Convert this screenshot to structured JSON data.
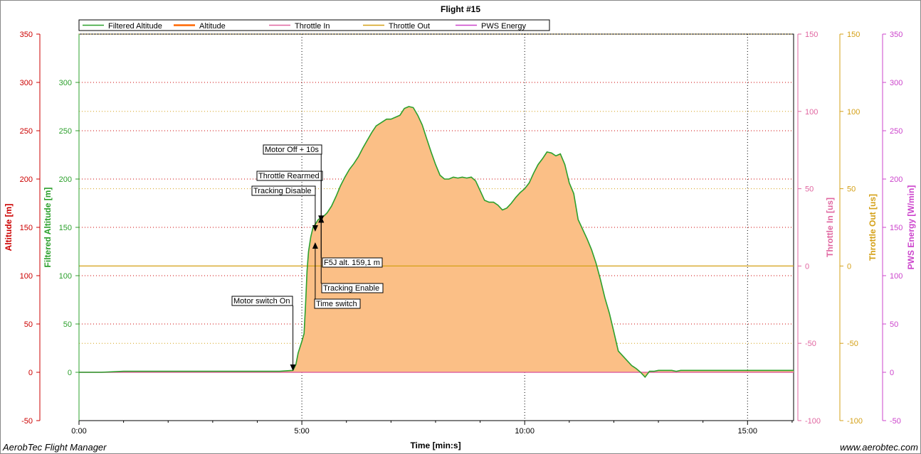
{
  "chart_data": {
    "type": "area",
    "title": "Flight #15",
    "xlabel": "Time [min:s]",
    "x_ticks": [
      "0:00",
      "5:00",
      "10:00",
      "15:00"
    ],
    "xlim_seconds": [
      0,
      962
    ],
    "legend": {
      "placement": "top-left",
      "entries": [
        {
          "name": "Filtered Altitude",
          "color": "#2ca02c"
        },
        {
          "name": "Altitude",
          "color": "#ff6600"
        },
        {
          "name": "Throttle In",
          "color": "#e066a0"
        },
        {
          "name": "Throttle Out",
          "color": "#d4a017"
        },
        {
          "name": "PWS Energy",
          "color": "#cc44cc"
        }
      ]
    },
    "axes": {
      "altitude": {
        "label": "Altitude [m]",
        "color": "#cc0000",
        "range": [
          -50,
          350
        ],
        "ticks": [
          "350",
          "300",
          "250",
          "200",
          "150",
          "100",
          "50",
          "0",
          "-50"
        ]
      },
      "filtered_altitude": {
        "label": "Filtered Altitude [m]",
        "color": "#2ca02c",
        "range": [
          -50,
          350
        ],
        "ticks": [
          "300",
          "250",
          "200",
          "150",
          "100",
          "50",
          "0"
        ]
      },
      "throttle_in": {
        "label": "Throttle In [us]",
        "color": "#e066a0",
        "range": [
          -100,
          150
        ],
        "ticks": [
          "150",
          "100",
          "50",
          "0",
          "-50",
          "-100"
        ]
      },
      "throttle_out": {
        "label": "Throttle Out [us]",
        "color": "#d4a017",
        "range": [
          -100,
          150
        ],
        "ticks": [
          "150",
          "100",
          "50",
          "0",
          "-50",
          "-100"
        ]
      },
      "pws_energy": {
        "label": "PWS Energy [W/min]",
        "color": "#cc44cc",
        "range": [
          -50,
          350
        ],
        "ticks": [
          "350",
          "300",
          "250",
          "200",
          "150",
          "100",
          "50",
          "0",
          "-50"
        ]
      }
    },
    "series": [
      {
        "name": "Altitude",
        "x_seconds": [
          0,
          30,
          60,
          90,
          120,
          150,
          180,
          210,
          240,
          270,
          288,
          292,
          295,
          300,
          303,
          305,
          307,
          309,
          312,
          315,
          318,
          322,
          326,
          330,
          334,
          340,
          346,
          352,
          358,
          364,
          370,
          376,
          382,
          388,
          394,
          400,
          408,
          414,
          420,
          426,
          432,
          438,
          444,
          450,
          456,
          462,
          468,
          474,
          480,
          486,
          492,
          498,
          504,
          510,
          516,
          522,
          528,
          534,
          540,
          546,
          552,
          558,
          564,
          570,
          576,
          582,
          588,
          594,
          600,
          606,
          612,
          618,
          624,
          630,
          636,
          642,
          648,
          654,
          660,
          666,
          672,
          678,
          684,
          690,
          696,
          702,
          708,
          714,
          720,
          726,
          732,
          738,
          744,
          750,
          756,
          762,
          768,
          774,
          780,
          786,
          792,
          798,
          804,
          810,
          816,
          822,
          828,
          834,
          840,
          846,
          852,
          858,
          864,
          870,
          876,
          882,
          886,
          890,
          896,
          902,
          908,
          914,
          920,
          930,
          940,
          950,
          962
        ],
        "y_m": [
          0,
          0,
          1,
          1,
          1,
          1,
          1,
          1,
          1,
          1,
          2,
          8,
          20,
          32,
          40,
          70,
          105,
          125,
          140,
          150,
          153,
          158,
          160,
          162,
          165,
          172,
          182,
          193,
          202,
          210,
          216,
          223,
          232,
          240,
          248,
          255,
          259,
          262,
          262,
          264,
          266,
          273,
          275,
          274,
          266,
          256,
          242,
          228,
          215,
          204,
          200,
          200,
          202,
          201,
          202,
          201,
          202,
          198,
          188,
          178,
          176,
          176,
          173,
          168,
          170,
          175,
          181,
          186,
          190,
          196,
          206,
          215,
          221,
          228,
          227,
          224,
          226,
          215,
          196,
          185,
          158,
          148,
          138,
          127,
          113,
          96,
          77,
          61,
          42,
          22,
          17,
          12,
          7,
          4,
          0,
          -5,
          1,
          1,
          2,
          2,
          2,
          2,
          1,
          2,
          2,
          2,
          2,
          2,
          2,
          2,
          2,
          2,
          2,
          2,
          2,
          2,
          2,
          2,
          2,
          2,
          2,
          2,
          2,
          2,
          2,
          2,
          2
        ]
      },
      {
        "name": "Filtered Altitude",
        "note_values_same_as": "Altitude"
      },
      {
        "name": "Throttle Out",
        "constant_value_us": 0
      }
    ],
    "annotations": [
      {
        "text": "Motor switch On",
        "x_seconds": 288,
        "y_m": 0
      },
      {
        "text": "Tracking Disable",
        "x_seconds": 318,
        "y_m": 148
      },
      {
        "text": "Throttle Rearmed",
        "x_seconds": 318,
        "y_m": 136
      },
      {
        "text": "Motor Off + 10s",
        "x_seconds": 326,
        "y_m": 160
      },
      {
        "text": "F5J alt. 159,1 m",
        "x_seconds": 326,
        "y_m": 160
      },
      {
        "text": "Tracking Enable",
        "x_seconds": 326,
        "y_m": 160
      },
      {
        "text": "Time switch",
        "x_seconds": 318,
        "y_m": 136
      }
    ],
    "grid": true
  },
  "footer": {
    "left": "AerobTec Flight Manager",
    "right": "www.aerobtec.com"
  }
}
